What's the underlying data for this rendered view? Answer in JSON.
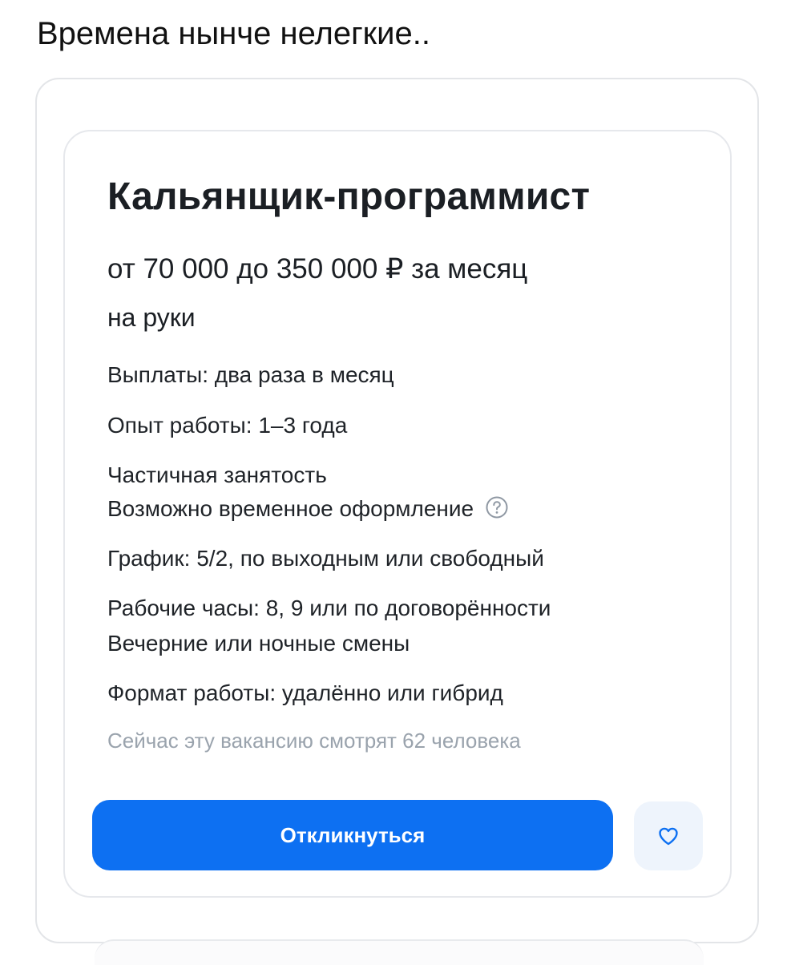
{
  "post": {
    "caption": "Времена нынче нелегкие.."
  },
  "vacancy": {
    "title": "Кальянщик-программист",
    "salary": "от 70 000 до 350 000 ₽ за месяц",
    "salary_note": "на руки",
    "payments": "Выплаты: два раза в месяц",
    "experience": "Опыт работы: 1–3 года",
    "employment": "Частичная занятость",
    "registration": "Возможно временное оформление",
    "schedule": "График: 5/2, по выходным или свободный",
    "hours": "Рабочие часы: 8, 9 или по договорённости",
    "shifts": "Вечерние или ночные смены",
    "format": "Формат работы: удалённо или гибрид",
    "viewers": "Сейчас эту вакансию смотрят 62 человека"
  },
  "actions": {
    "apply_label": "Откликнуться",
    "help_icon": "question-circle-icon",
    "favorite_icon": "heart-icon"
  },
  "colors": {
    "accent": "#0d70f2",
    "muted_text": "#9aa3ad",
    "favorite_bg": "#eef4fc"
  }
}
